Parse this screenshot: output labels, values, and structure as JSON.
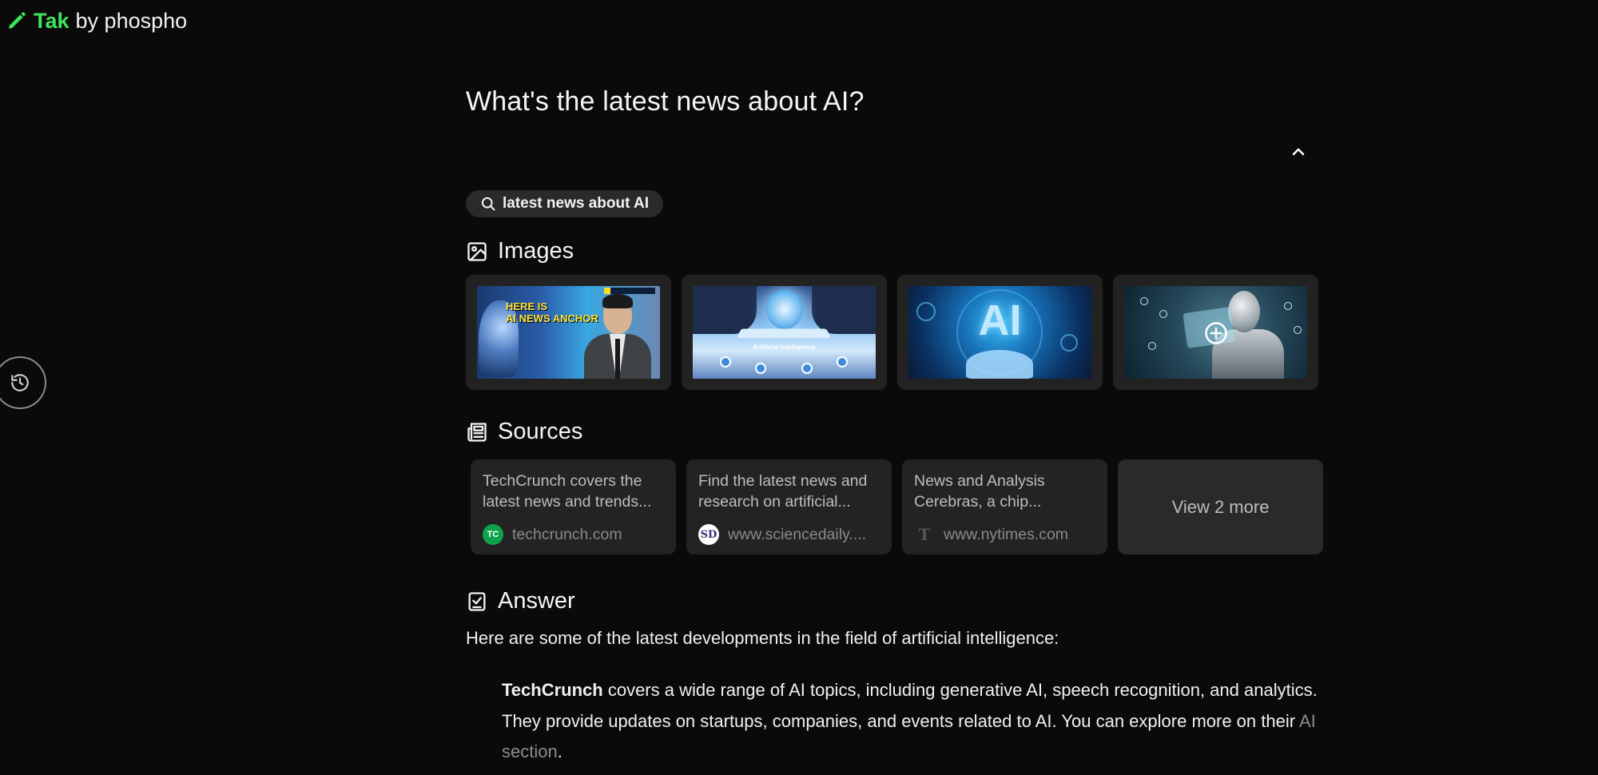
{
  "brand": {
    "name": "Tak",
    "by": "by phospho",
    "icon": "pencil-icon",
    "accent_color": "#3ee55a"
  },
  "history": {
    "icon": "history-icon"
  },
  "question": "What's the latest news about AI?",
  "collapse": {
    "icon": "chevron-up-icon"
  },
  "query_chip": {
    "icon": "search-icon",
    "label": "latest news about AI"
  },
  "images": {
    "heading": "Images",
    "icon": "image-icon",
    "thumb1_text_line1": "HERE IS",
    "thumb1_text_line2": "AI NEWS ANCHOR",
    "thumb2_caption": "Artificial intelligence",
    "thumb3_text": "AI",
    "more_icon": "plus-circle-icon"
  },
  "sources": {
    "heading": "Sources",
    "icon": "newspaper-icon",
    "items": [
      {
        "description": "TechCrunch covers the latest news and trends...",
        "domain": "techcrunch.com",
        "favicon_text": "TC"
      },
      {
        "description": "Find the latest news and research on artificial...",
        "domain": "www.sciencedaily....",
        "favicon_text": "SD"
      },
      {
        "description": "News and Analysis Cerebras, a chip...",
        "domain": "www.nytimes.com",
        "favicon_text": "T"
      }
    ],
    "view_more": "View 2 more"
  },
  "answer": {
    "heading": "Answer",
    "icon": "checklist-icon",
    "intro": "Here are some of the latest developments in the field of artificial intelligence:",
    "para1_bold": "TechCrunch",
    "para1_text": " covers a wide range of AI topics, including generative AI, speech recognition, and analytics. They provide updates on startups, companies, and events related to AI. You can explore more on their ",
    "para1_link": "AI section",
    "para1_end": "."
  }
}
